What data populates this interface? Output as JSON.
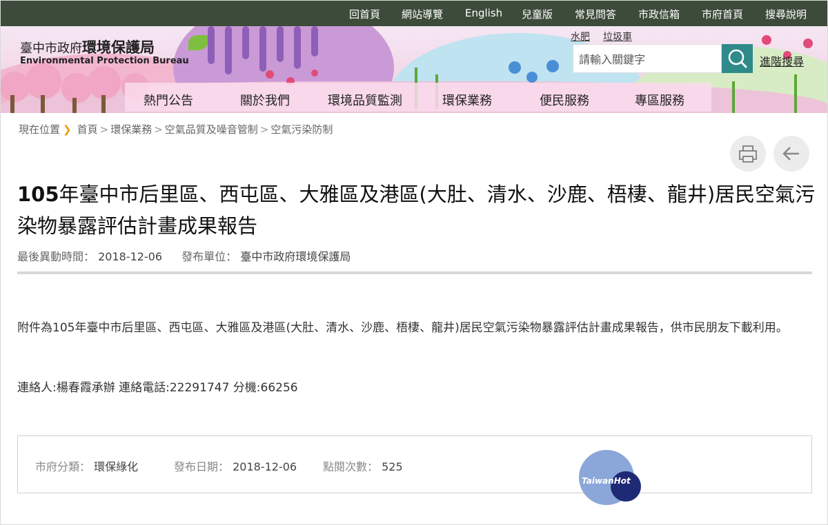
{
  "topbar": {
    "links": [
      "回首頁",
      "網站導覽",
      "English",
      "兒童版",
      "常見問答",
      "市政信箱",
      "市府首頁",
      "搜尋說明"
    ]
  },
  "logo": {
    "cn_prefix": "臺中市政府",
    "cn_main": "環境保護局",
    "en": "Environmental Protection Bureau"
  },
  "quick_links": [
    "水肥",
    "垃圾車"
  ],
  "search": {
    "placeholder": "請輸入關鍵字",
    "advanced": "進階搜尋"
  },
  "nav": [
    "熱門公告",
    "關於我們",
    "環境品質監測",
    "環保業務",
    "便民服務",
    "專區服務"
  ],
  "breadcrumb": {
    "label": "現在位置",
    "items": [
      "首頁",
      "環保業務",
      "空氣品質及噪音管制",
      "空氣污染防制"
    ]
  },
  "article": {
    "title_bold": "105",
    "title_rest": "年臺中市后里區、西屯區、大雅區及港區(大肚、清水、沙鹿、梧棲、龍井)居民空氣污染物暴露評估計畫成果報告",
    "updated_label": "最後異動時間：",
    "updated_value": "2018-12-06",
    "unit_label": "發布單位：",
    "unit_value": "臺中市政府環境保護局",
    "body": "附件為105年臺中市后里區、西屯區、大雅區及港區(大肚、清水、沙鹿、梧棲、龍井)居民空氣污染物暴露評估計畫成果報告，供市民朋友下載利用。",
    "contact": "連絡人:楊春霞承辦 連絡電話:22291747 分機:66256"
  },
  "info": {
    "category_label": "市府分類：",
    "category_value": "環保綠化",
    "date_label": "發布日期：",
    "date_value": "2018-12-06",
    "views_label": "點閱次數：",
    "views_value": "525"
  },
  "watermark": "TaiwanHot",
  "icons": [
    "search-icon",
    "print-icon",
    "back-arrow-icon",
    "chevron-right-icon"
  ],
  "colors": {
    "topbar": "#3d4b3a",
    "search_button": "#2f8a8a",
    "breadcrumb_chevron": "#e8a000"
  }
}
